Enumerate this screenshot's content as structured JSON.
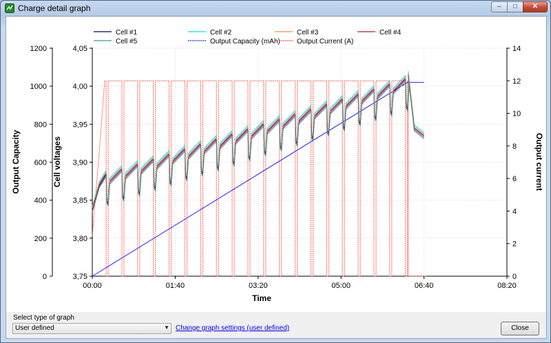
{
  "window": {
    "title": "Charge detail graph",
    "min_glyph": "–",
    "max_glyph": "□",
    "close_glyph": "✕"
  },
  "bottom": {
    "select_label": "Select type of graph",
    "select_value": "User defined",
    "settings_link": "Change graph settings (user defined)",
    "close_label": "Close"
  },
  "chart_data": {
    "type": "line",
    "xlabel": "Time",
    "x_ticks": [
      "00:00",
      "01:40",
      "03:20",
      "05:00",
      "06:40",
      "08:20"
    ],
    "x_range_seconds": [
      0,
      30000
    ],
    "left_axis": {
      "label": "Output Capacity",
      "ticks": [
        "0",
        "200",
        "400",
        "600",
        "800",
        "1000",
        "1200"
      ],
      "ylim": [
        0,
        1200
      ]
    },
    "middle_axis": {
      "label": "Cell voltages",
      "ticks": [
        "3,75",
        "3,80",
        "3,85",
        "3,90",
        "3,95",
        "4,00",
        "4,05"
      ],
      "ylim": [
        3.75,
        4.05
      ]
    },
    "right_axis": {
      "label": "Output current",
      "ticks": [
        "0",
        "2",
        "4",
        "6",
        "8",
        "10",
        "12",
        "14"
      ],
      "ylim": [
        0,
        14
      ]
    },
    "legend": [
      {
        "name": "Cell #1",
        "color": "#000080",
        "dashed": false
      },
      {
        "name": "Cell #2",
        "color": "#00e5ee",
        "dashed": false
      },
      {
        "name": "Cell #3",
        "color": "#ff8c42",
        "dashed": false
      },
      {
        "name": "Cell #4",
        "color": "#cc1030",
        "dashed": false
      },
      {
        "name": "Cell #5",
        "color": "#3c9a98",
        "dashed": false
      },
      {
        "name": "Output Capacity (mAh)",
        "color": "#2020ff",
        "dashed": true
      },
      {
        "name": "Output Current (A)",
        "color": "#ff4a3a",
        "dashed": true
      }
    ],
    "capacity_series": {
      "name": "Output Capacity (mAh)",
      "time_seconds": [
        0,
        22800,
        24000
      ],
      "values": [
        0,
        1020,
        1020
      ]
    },
    "current_series": {
      "name": "Output Current (A)",
      "regular_current_A": 12,
      "pulse_current_A": 0,
      "regular_pulse_period_seconds": 1140,
      "pulse_width_seconds": 150,
      "end_time_seconds": 22860
    },
    "cell_voltage_summary": {
      "start_V": 3.838,
      "first_peak_V": 3.885,
      "final_peak_V": 4.01,
      "after_charge_V": 3.935
    }
  }
}
